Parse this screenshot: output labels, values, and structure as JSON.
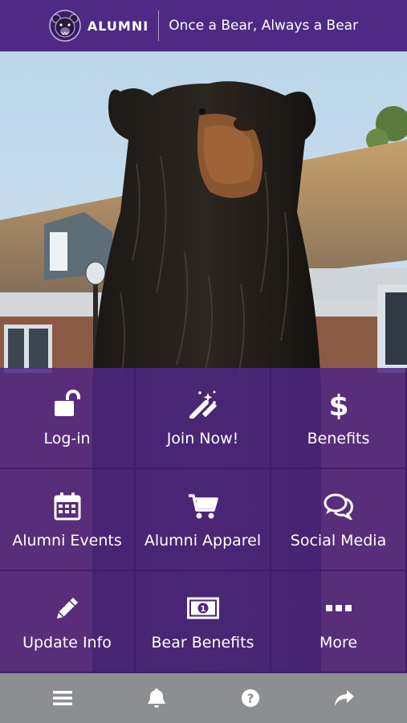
{
  "header": {
    "logo_text": "ALUMNI",
    "tagline": "Once a Bear, Always a Bear"
  },
  "tiles": [
    {
      "label": "Log-in",
      "icon": "unlock-icon"
    },
    {
      "label": "Join Now!",
      "icon": "magic-wand-icon"
    },
    {
      "label": "Benefits",
      "icon": "dollar-icon"
    },
    {
      "label": "Alumni Events",
      "icon": "calendar-icon"
    },
    {
      "label": "Alumni Apparel",
      "icon": "shopping-cart-icon"
    },
    {
      "label": "Social Media",
      "icon": "chat-bubbles-icon"
    },
    {
      "label": "Update Info",
      "icon": "pencil-icon"
    },
    {
      "label": "Bear Benefits",
      "icon": "money-bill-icon"
    },
    {
      "label": "More",
      "icon": "ellipsis-icon"
    }
  ],
  "bottom_nav": [
    {
      "icon": "menu-icon"
    },
    {
      "icon": "bell-icon"
    },
    {
      "icon": "help-icon"
    },
    {
      "icon": "share-icon"
    }
  ],
  "colors": {
    "brand_purple": "#4e2a84",
    "tile_purple": "#4f2683",
    "bottom_bar": "#8d8e90"
  }
}
